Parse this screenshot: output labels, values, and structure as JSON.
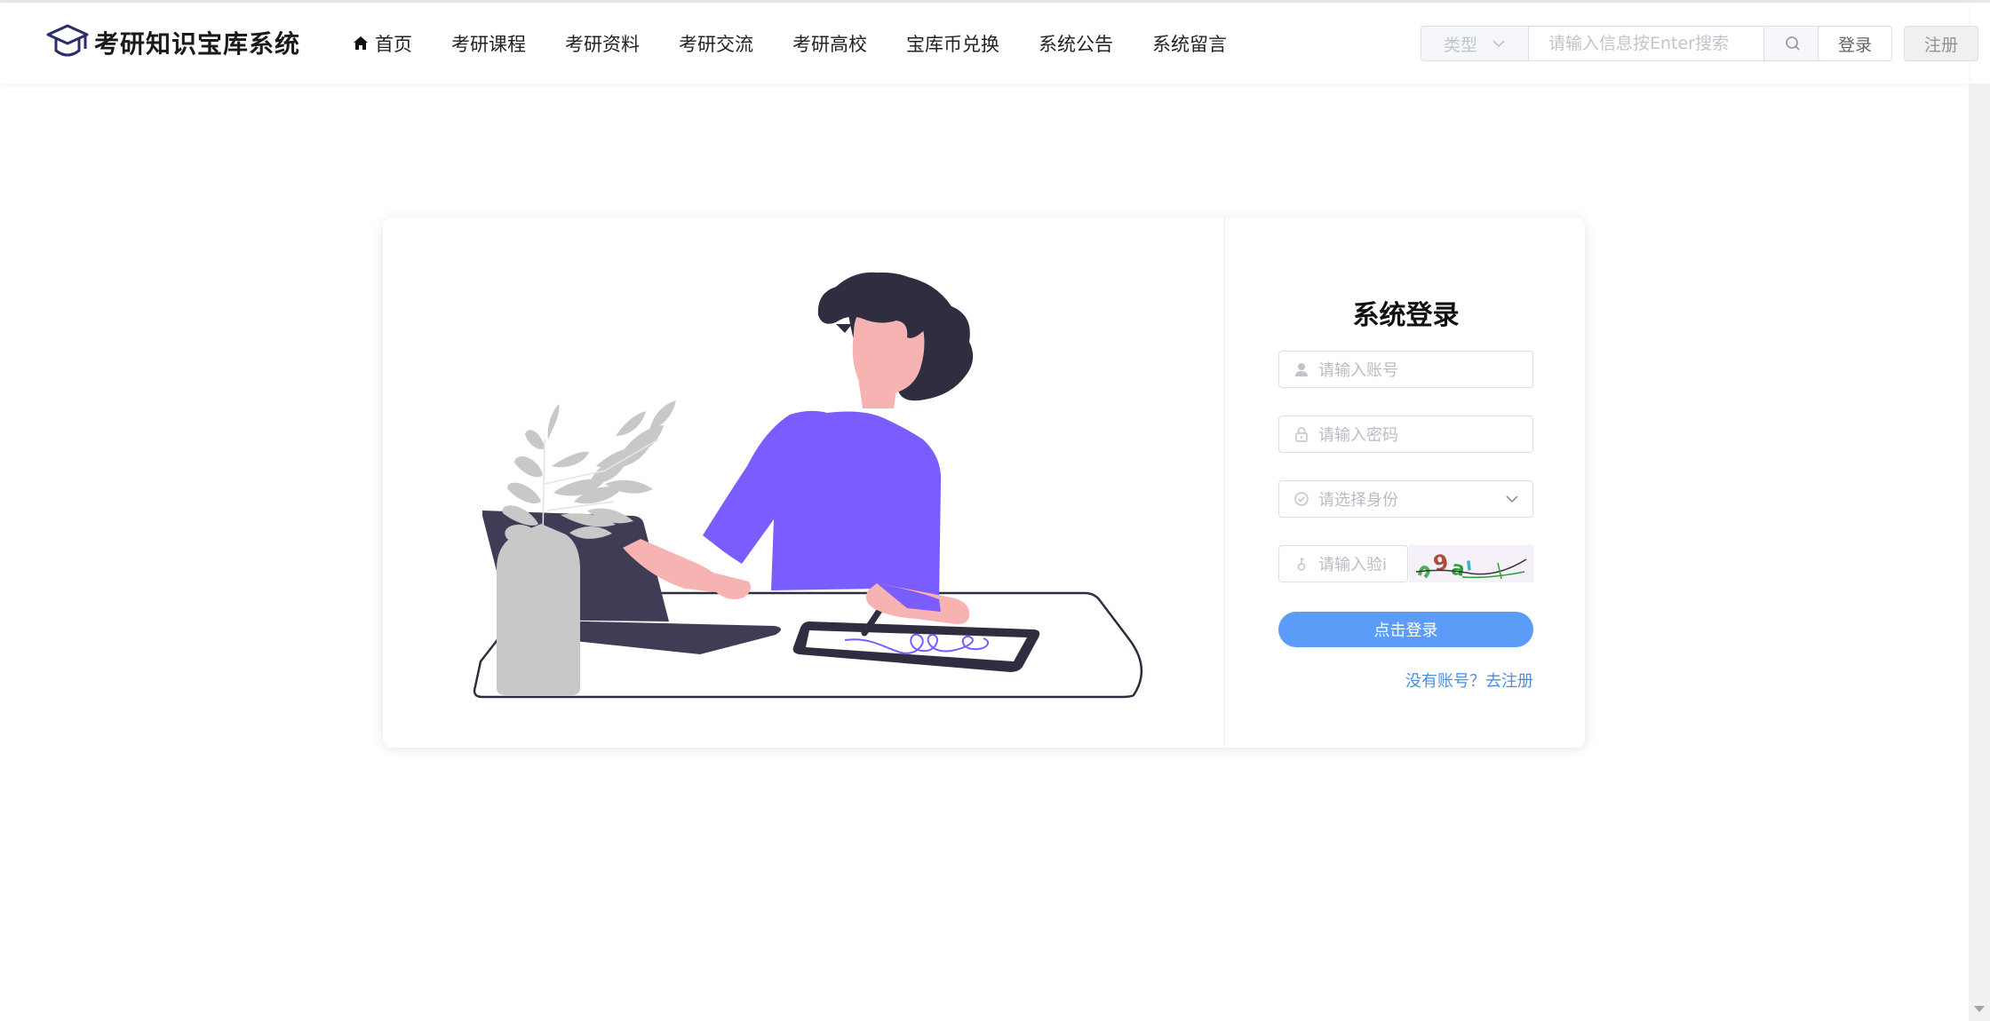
{
  "header": {
    "site_title": "考研知识宝库系统",
    "logo_icon": "graduation-cap-icon",
    "nav": [
      {
        "label": "首页",
        "icon": "home-icon"
      },
      {
        "label": "考研课程"
      },
      {
        "label": "考研资料"
      },
      {
        "label": "考研交流"
      },
      {
        "label": "考研高校"
      },
      {
        "label": "宝库币兑换"
      },
      {
        "label": "系统公告"
      },
      {
        "label": "系统留言"
      }
    ],
    "search": {
      "type_label": "类型",
      "placeholder": "请输入信息按Enter搜索",
      "button_icon": "search-icon"
    },
    "login_label": "登录",
    "register_label": "注册"
  },
  "login": {
    "title": "系统登录",
    "account_placeholder": "请输入账号",
    "password_placeholder": "请输入密码",
    "role_placeholder": "请选择身份",
    "captcha_placeholder": "请输入验证码",
    "captcha_placeholder_visible": "请输入验i",
    "submit_label": "点击登录",
    "register_link": "没有账号？去注册"
  },
  "colors": {
    "accent": "#5a9cf8",
    "illustration_shirt": "#7b5cff",
    "illustration_dark": "#2f2e41"
  }
}
